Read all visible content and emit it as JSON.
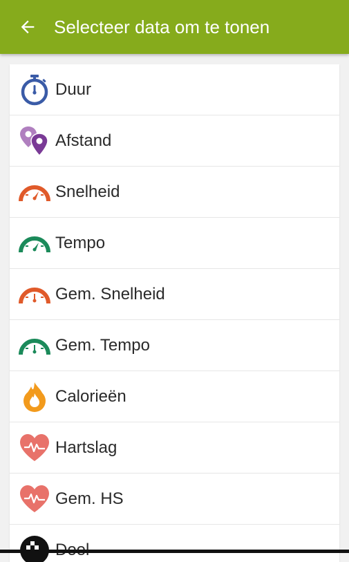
{
  "header": {
    "title": "Selecteer data om te tonen",
    "background": "#86ab1c"
  },
  "items": [
    {
      "label": "Duur",
      "icon": "stopwatch-icon",
      "color": "#3a5ba7"
    },
    {
      "label": "Afstand",
      "icon": "location-pins-icon",
      "color": "#7a3a96"
    },
    {
      "label": "Snelheid",
      "icon": "speedometer-icon",
      "color": "#e05a2a"
    },
    {
      "label": "Tempo",
      "icon": "speedometer-icon",
      "color": "#1b8a5a"
    },
    {
      "label": "Gem. Snelheid",
      "icon": "speedometer-icon",
      "color": "#e05a2a"
    },
    {
      "label": "Gem. Tempo",
      "icon": "speedometer-icon",
      "color": "#1b8a5a"
    },
    {
      "label": "Calorieën",
      "icon": "flame-icon",
      "color": "#f29a1c"
    },
    {
      "label": "Hartslag",
      "icon": "heart-pulse-icon",
      "color": "#e8726a"
    },
    {
      "label": "Gem. HS",
      "icon": "heart-pulse-icon",
      "color": "#e8726a"
    },
    {
      "label": "Doel",
      "icon": "target-flag-icon",
      "color": "#111111"
    }
  ]
}
